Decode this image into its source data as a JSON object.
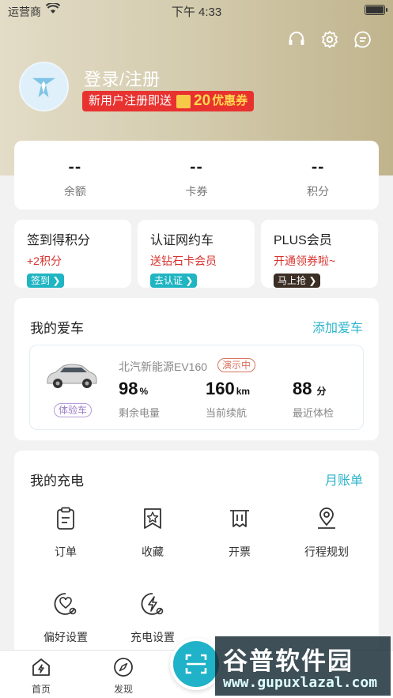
{
  "status_bar": {
    "carrier": "运营商",
    "time": "下午 4:33"
  },
  "header": {
    "login_title": "登录/注册",
    "promo": {
      "prefix": "新用户注册即送",
      "amount": "20",
      "suffix": "优惠券"
    }
  },
  "stats": [
    {
      "value": "--",
      "label": "余额"
    },
    {
      "value": "--",
      "label": "卡券"
    },
    {
      "value": "--",
      "label": "积分"
    }
  ],
  "promo_cards": [
    {
      "title": "签到得积分",
      "subtitle": "+2积分",
      "button": "签到"
    },
    {
      "title": "认证网约车",
      "subtitle": "送钻石卡会员",
      "button": "去认证"
    },
    {
      "title": "PLUS会员",
      "subtitle": "开通领券啦~",
      "button": "马上抢"
    }
  ],
  "my_car": {
    "title": "我的爱车",
    "add_link": "添加爱车",
    "car_name": "北汽新能源EV160",
    "demo_badge": "演示中",
    "trial_badge": "体验车",
    "metrics": [
      {
        "value": "98",
        "unit": "%",
        "label": "剩余电量"
      },
      {
        "value": "160",
        "unit": "km",
        "label": "当前续航"
      },
      {
        "value": "88",
        "unit": "分",
        "label": "最近体检"
      }
    ]
  },
  "my_charging": {
    "title": "我的充电",
    "bill_link": "月账单",
    "items": [
      {
        "label": "订单",
        "icon": "clipboard-icon"
      },
      {
        "label": "收藏",
        "icon": "bookmark-star-icon"
      },
      {
        "label": "开票",
        "icon": "receipt-icon"
      },
      {
        "label": "行程规划",
        "icon": "map-pin-icon"
      },
      {
        "label": "偏好设置",
        "icon": "heart-settings-icon"
      },
      {
        "label": "充电设置",
        "icon": "lightning-settings-icon"
      }
    ]
  },
  "tabbar": [
    {
      "label": "首页",
      "icon": "home-lightning-icon"
    },
    {
      "label": "发现",
      "icon": "compass-icon"
    }
  ],
  "watermark": {
    "title": "谷普软件园",
    "url": "www.gupuxlazal.com"
  },
  "colors": {
    "accent": "#1fb2c8",
    "promo_red": "#e8322f",
    "link": "#2bb3cc"
  }
}
